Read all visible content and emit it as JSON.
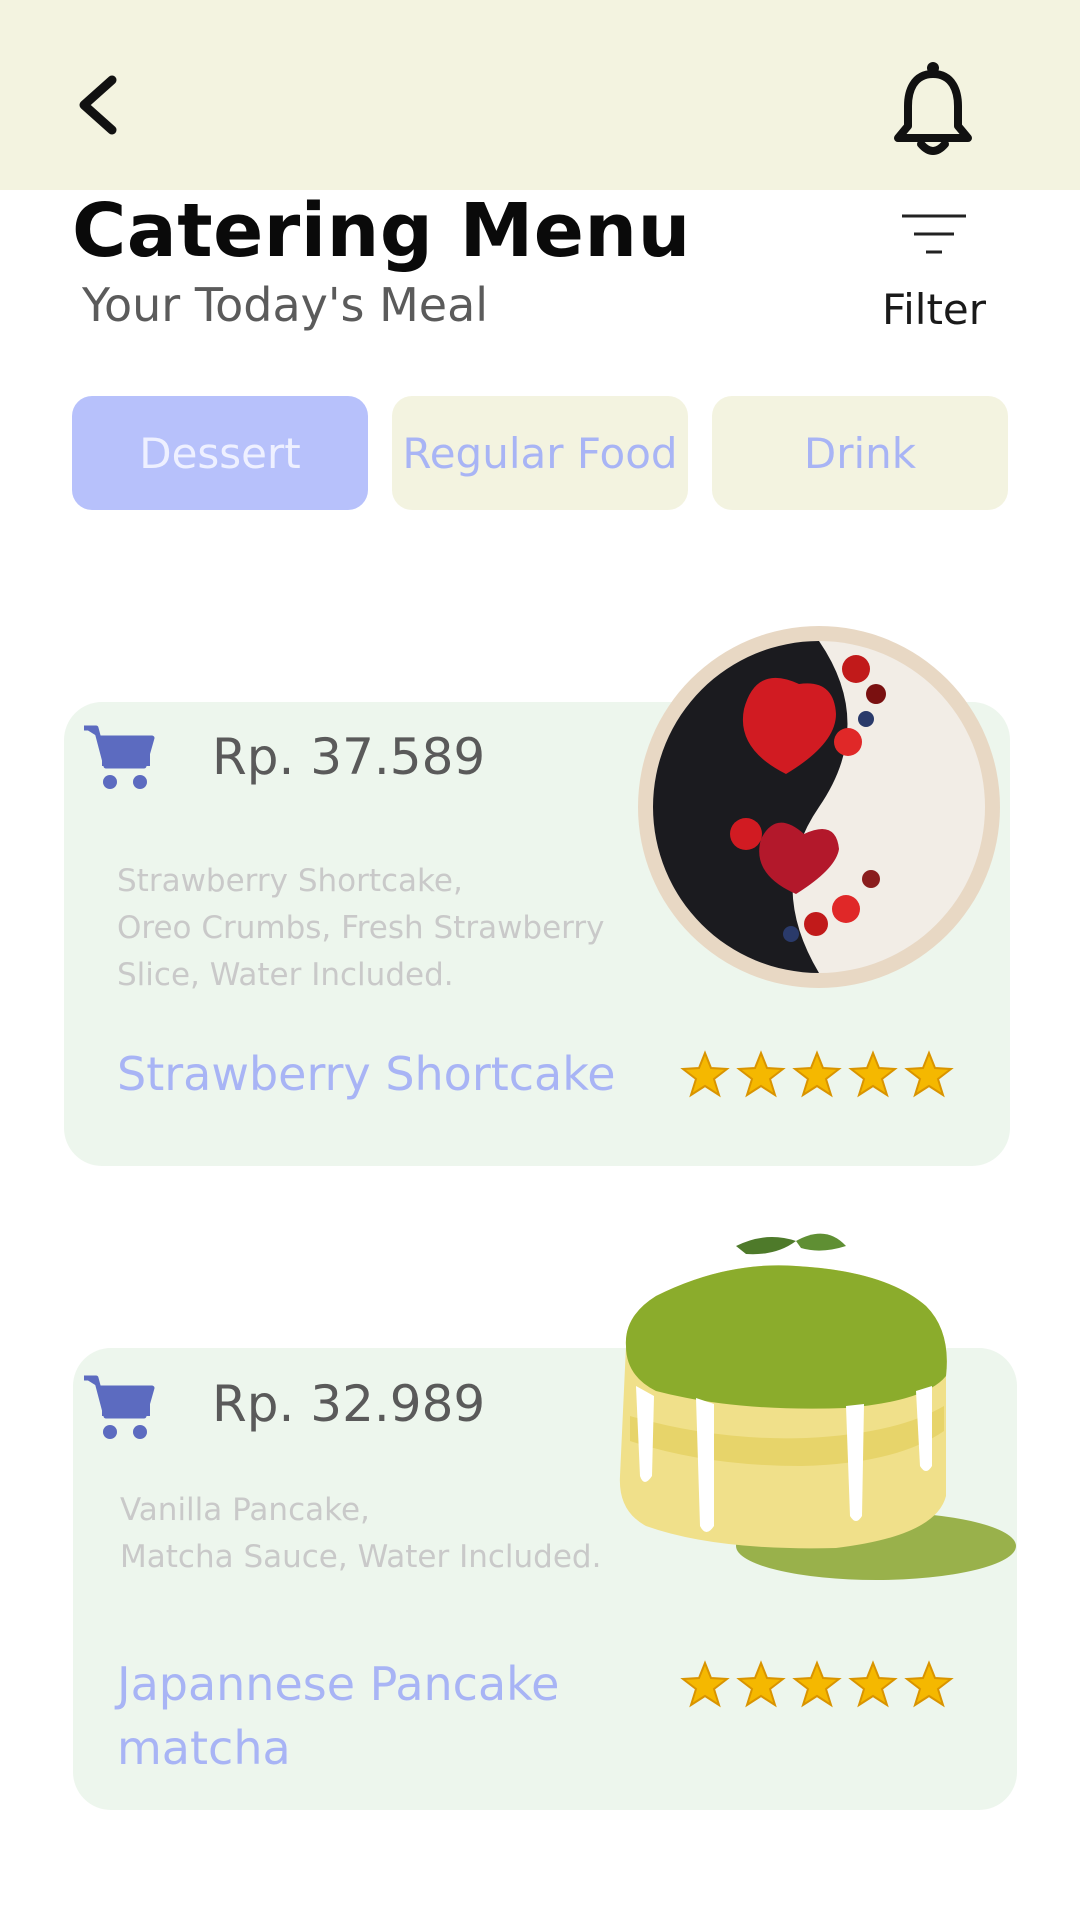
{
  "header": {
    "back_icon": "chevron-left-icon",
    "bell_icon": "bell-icon"
  },
  "page": {
    "title": "Catering Menu",
    "subtitle": "Your Today's Meal",
    "filter_label": "Filter",
    "filter_icon": "filter-lines-icon"
  },
  "tabs": [
    {
      "label": "Dessert",
      "active": true
    },
    {
      "label": "Regular Food",
      "active": false
    },
    {
      "label": "Drink",
      "active": false
    }
  ],
  "colors": {
    "header_bg": "#f3f3e0",
    "accent": "#b7c1fb",
    "card_bg": "#edf6ed",
    "cart": "#5c6bc0",
    "star": "#f5b800"
  },
  "items": [
    {
      "price": "Rp. 37.589",
      "description": [
        "Strawberry Shortcake,",
        "Oreo Crumbs, Fresh Strawberry",
        "Slice, Water Included."
      ],
      "name": "Strawberry Shortcake",
      "rating": 5
    },
    {
      "price": "Rp. 32.989",
      "description": [
        "Vanilla Pancake,",
        "Matcha Sauce, Water Included."
      ],
      "name": "Japannese Pancake matcha",
      "rating": 5
    }
  ]
}
